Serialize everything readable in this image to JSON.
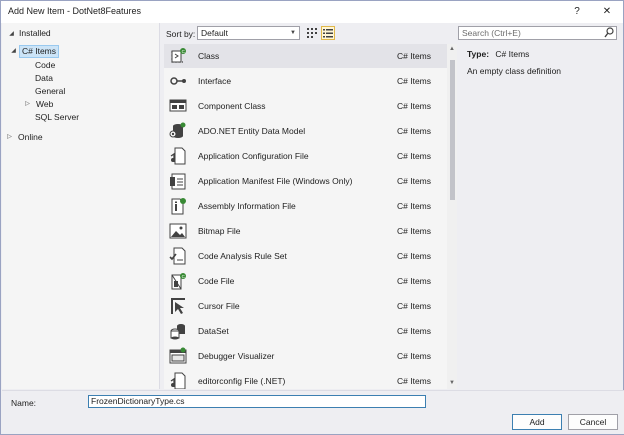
{
  "window": {
    "title": "Add New Item - DotNet8Features",
    "help_label": "?",
    "close_label": "✕"
  },
  "tree": {
    "installed_label": "Installed",
    "csharp_items_label": "C# Items",
    "children": [
      "Code",
      "Data",
      "General",
      "Web",
      "SQL Server"
    ],
    "online_label": "Online"
  },
  "toolbar": {
    "sort_label": "Sort by:",
    "sort_value": "Default"
  },
  "search": {
    "placeholder": "Search (Ctrl+E)"
  },
  "items": [
    {
      "name": "Class",
      "category": "C# Items",
      "icon": "class-icon"
    },
    {
      "name": "Interface",
      "category": "C# Items",
      "icon": "interface-icon"
    },
    {
      "name": "Component Class",
      "category": "C# Items",
      "icon": "component-class-icon"
    },
    {
      "name": "ADO.NET Entity Data Model",
      "category": "C# Items",
      "icon": "entity-data-model-icon"
    },
    {
      "name": "Application Configuration File",
      "category": "C# Items",
      "icon": "config-file-icon"
    },
    {
      "name": "Application Manifest File (Windows Only)",
      "category": "C# Items",
      "icon": "manifest-file-icon"
    },
    {
      "name": "Assembly Information File",
      "category": "C# Items",
      "icon": "assembly-info-icon"
    },
    {
      "name": "Bitmap File",
      "category": "C# Items",
      "icon": "bitmap-icon"
    },
    {
      "name": "Code Analysis Rule Set",
      "category": "C# Items",
      "icon": "rule-set-icon"
    },
    {
      "name": "Code File",
      "category": "C# Items",
      "icon": "code-file-icon"
    },
    {
      "name": "Cursor File",
      "category": "C# Items",
      "icon": "cursor-icon"
    },
    {
      "name": "DataSet",
      "category": "C# Items",
      "icon": "dataset-icon"
    },
    {
      "name": "Debugger Visualizer",
      "category": "C# Items",
      "icon": "debugger-visualizer-icon"
    },
    {
      "name": "editorconfig File (.NET)",
      "category": "C# Items",
      "icon": "editorconfig-icon"
    }
  ],
  "details": {
    "type_label": "Type:",
    "type_value": "C# Items",
    "description": "An empty class definition"
  },
  "bottom": {
    "name_label": "Name:",
    "name_value": "FrozenDictionaryType.cs",
    "add_label": "Add",
    "cancel_label": "Cancel"
  },
  "colors": {
    "accent": "#3c7fb1",
    "selection": "#cce4f7",
    "green_badge": "#388a34",
    "icon_dark": "#424242"
  }
}
